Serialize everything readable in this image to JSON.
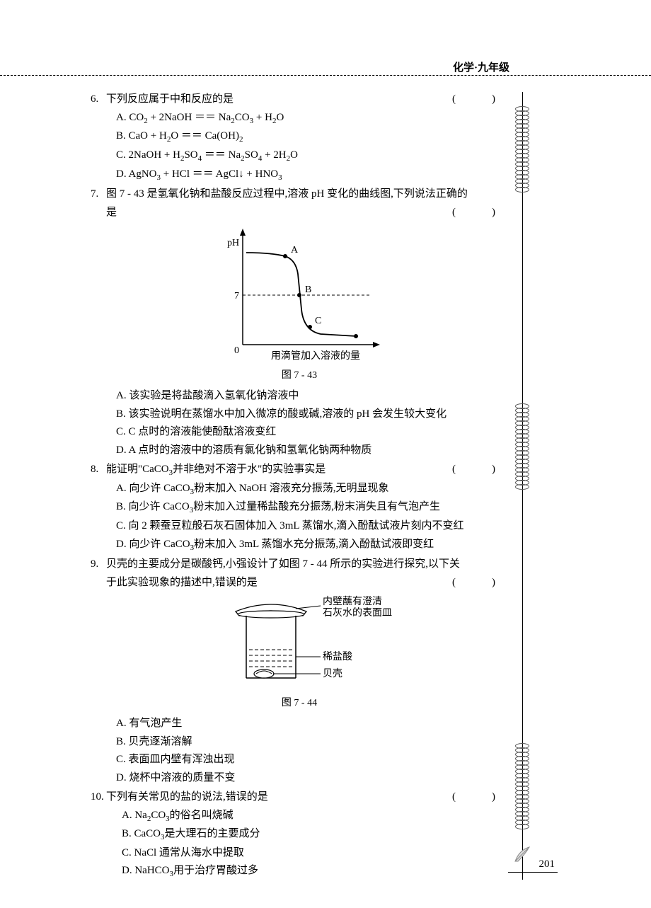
{
  "header": {
    "title": "化学·九年级"
  },
  "q6": {
    "num": "6.",
    "stem": "下列反应属于中和反应的是",
    "paren": "(　)",
    "a_label": "A.",
    "a": "CO₂ + 2NaOH ＝＝ Na₂CO₃ + H₂O",
    "b_label": "B.",
    "b": "CaO + H₂O ＝＝ Ca(OH)₂",
    "c_label": "C.",
    "c": "2NaOH + H₂SO₄ ＝＝ Na₂SO₄ + 2H₂O",
    "d_label": "D.",
    "d": "AgNO₃ + HCl ＝＝ AgCl↓ + HNO₃"
  },
  "q7": {
    "num": "7.",
    "stem1": "图 7 - 43 是氢氧化钠和盐酸反应过程中,溶液 pH 变化的曲线图,下列说法正确的",
    "stem2": "是",
    "paren": "(　)",
    "fig": {
      "y_label": "pH",
      "y_tick": "7",
      "origin": "0",
      "x_label": "用滴管加入溶液的量",
      "pointA": "A",
      "pointB": "B",
      "pointC": "C",
      "caption": "图 7 - 43"
    },
    "a": "A. 该实验是将盐酸滴入氢氧化钠溶液中",
    "b": "B. 该实验说明在蒸馏水中加入微凉的酸或碱,溶液的 pH 会发生较大变化",
    "c": "C. C 点时的溶液能使酚酞溶液变红",
    "d": "D. A 点时的溶液中的溶质有氯化钠和氢氧化钠两种物质"
  },
  "q8": {
    "num": "8.",
    "stem": "能证明\"CaCO₃并非绝对不溶于水\"的实验事实是",
    "paren": "(　)",
    "a": "A. 向少许 CaCO₃粉末加入 NaOH 溶液充分振荡,无明显现象",
    "b": "B. 向少许 CaCO₃粉末加入过量稀盐酸充分振荡,粉末消失且有气泡产生",
    "c": "C. 向 2 颗蚕豆粒般石灰石固体加入 3mL 蒸馏水,滴入酚酞试液片刻内不变红",
    "d": "D. 向少许 CaCO₃粉末加入 3mL 蒸馏水充分振荡,滴入酚酞试液即变红"
  },
  "q9": {
    "num": "9.",
    "stem1": "贝壳的主要成分是碳酸钙,小强设计了如图 7 - 44 所示的实验进行探究,以下关",
    "stem2": "于此实验现象的描述中,错误的是",
    "paren": "(　)",
    "fig": {
      "label_dish1": "内壁蘸有澄清",
      "label_dish2": "石灰水的表面皿",
      "label_acid": "稀盐酸",
      "label_shell": "贝壳",
      "caption": "图 7 - 44"
    },
    "a": "A. 有气泡产生",
    "b": "B. 贝壳逐渐溶解",
    "c": "C. 表面皿内壁有浑浊出现",
    "d": "D. 烧杯中溶液的质量不变"
  },
  "q10": {
    "num": "10.",
    "stem": "下列有关常见的盐的说法,错误的是",
    "paren": "(　)",
    "a": "A. Na₂CO₃的俗名叫烧碱",
    "b": "B. CaCO₃是大理石的主要成分",
    "c": "C. NaCl 通常从海水中提取",
    "d": "D. NaHCO₃用于治疗胃酸过多"
  },
  "page_number": "201",
  "chart_data": {
    "type": "line",
    "title": "图 7-43",
    "xlabel": "用滴管加入溶液的量",
    "ylabel": "pH",
    "ylim": [
      0,
      14
    ],
    "x": [
      0,
      20,
      35,
      50,
      55,
      60,
      80,
      110
    ],
    "y": [
      13,
      12.8,
      12.5,
      10,
      7,
      4,
      1.5,
      1.2
    ],
    "annotations": [
      {
        "label": "A",
        "x": 35,
        "y": 12.5
      },
      {
        "label": "B",
        "x": 55,
        "y": 7
      },
      {
        "label": "C",
        "x": 66,
        "y": 2.5
      }
    ],
    "reference_lines": [
      {
        "axis": "y",
        "value": 7,
        "style": "dashed"
      }
    ]
  }
}
